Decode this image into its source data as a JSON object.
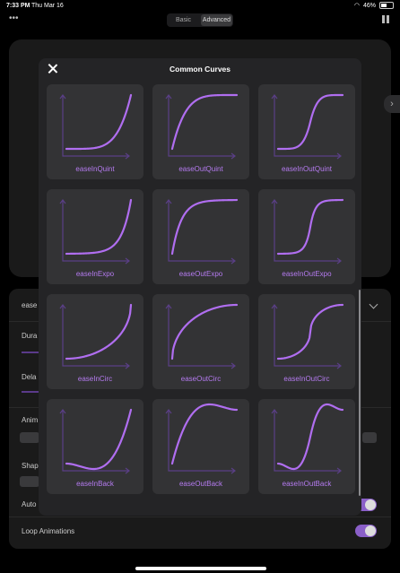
{
  "status": {
    "time": "7:33 PM",
    "date": "Thu Mar 16",
    "battery": "46%"
  },
  "toolbar": {
    "menu_icon": "ellipsis-icon",
    "tabs": [
      "Basic",
      "Advanced"
    ],
    "selected_tab": "Advanced"
  },
  "settings": {
    "curve_value": "ease",
    "duration_label": "Dura",
    "delay_label": "Dela",
    "anim_label": "Anim",
    "shape_label": "Shap",
    "auto_label": "Auto",
    "loop_label": "Loop Animations"
  },
  "modal": {
    "title": "Common Curves",
    "curves": [
      {
        "label": "easeInQuint",
        "type": "inQuint"
      },
      {
        "label": "easeOutQuint",
        "type": "outQuint"
      },
      {
        "label": "easeInOutQuint",
        "type": "inOutQuint"
      },
      {
        "label": "easeInExpo",
        "type": "inExpo"
      },
      {
        "label": "easeOutExpo",
        "type": "outExpo"
      },
      {
        "label": "easeInOutExpo",
        "type": "inOutExpo"
      },
      {
        "label": "easeInCirc",
        "type": "inCirc"
      },
      {
        "label": "easeOutCirc",
        "type": "outCirc"
      },
      {
        "label": "easeInOutCirc",
        "type": "inOutCirc"
      },
      {
        "label": "easeInBack",
        "type": "inBack"
      },
      {
        "label": "easeOutBack",
        "type": "outBack"
      },
      {
        "label": "easeInOutBack",
        "type": "inOutBack"
      }
    ]
  },
  "colors": {
    "curve": "#b06ef0",
    "axis": "#5a3f86",
    "label": "#b57bf0",
    "toggle": "#8a5fc8"
  }
}
